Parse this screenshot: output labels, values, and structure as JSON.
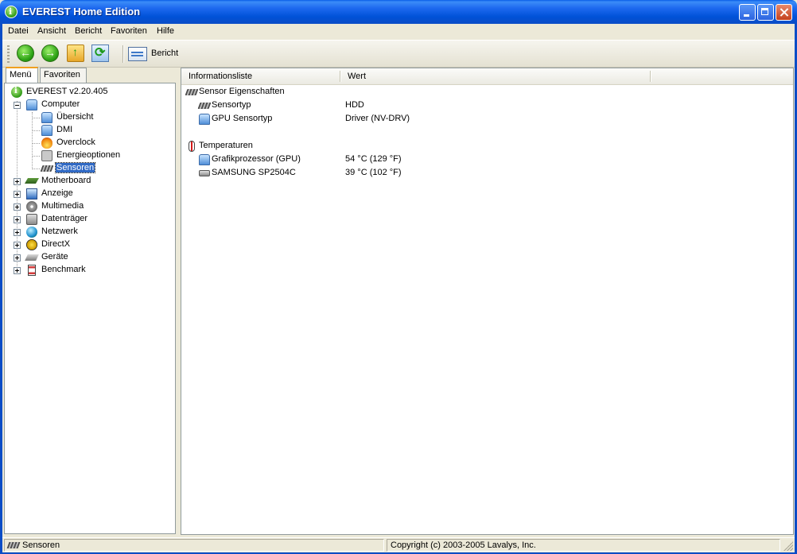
{
  "window": {
    "title": "EVEREST Home Edition"
  },
  "menu": [
    "Datei",
    "Ansicht",
    "Bericht",
    "Favoriten",
    "Hilfe"
  ],
  "toolbar": {
    "report_label": "Bericht"
  },
  "left_tabs": [
    "Menü",
    "Favoriten"
  ],
  "tree": {
    "root": "EVEREST v2.20.405",
    "computer": "Computer",
    "computer_children": [
      "Übersicht",
      "DMI",
      "Overclock",
      "Energieoptionen",
      "Sensoren"
    ],
    "categories": [
      "Motherboard",
      "Anzeige",
      "Multimedia",
      "Datenträger",
      "Netzwerk",
      "DirectX",
      "Geräte",
      "Benchmark"
    ]
  },
  "columns": {
    "info": "Informationsliste",
    "value": "Wert"
  },
  "sections": {
    "sensor_props": "Sensor Eigenschaften",
    "temps": "Temperaturen"
  },
  "rows": {
    "sensortyp": {
      "label": "Sensortyp",
      "value": "HDD"
    },
    "gpu_sensortyp": {
      "label": "GPU Sensortyp",
      "value": "Driver  (NV-DRV)"
    },
    "gpu_temp": {
      "label": "Grafikprozessor (GPU)",
      "value": "54 °C  (129 °F)"
    },
    "hdd_temp": {
      "label": "SAMSUNG SP2504C",
      "value": "39 °C  (102 °F)"
    }
  },
  "status": {
    "left": "Sensoren",
    "right": "Copyright (c) 2003-2005 Lavalys, Inc."
  }
}
